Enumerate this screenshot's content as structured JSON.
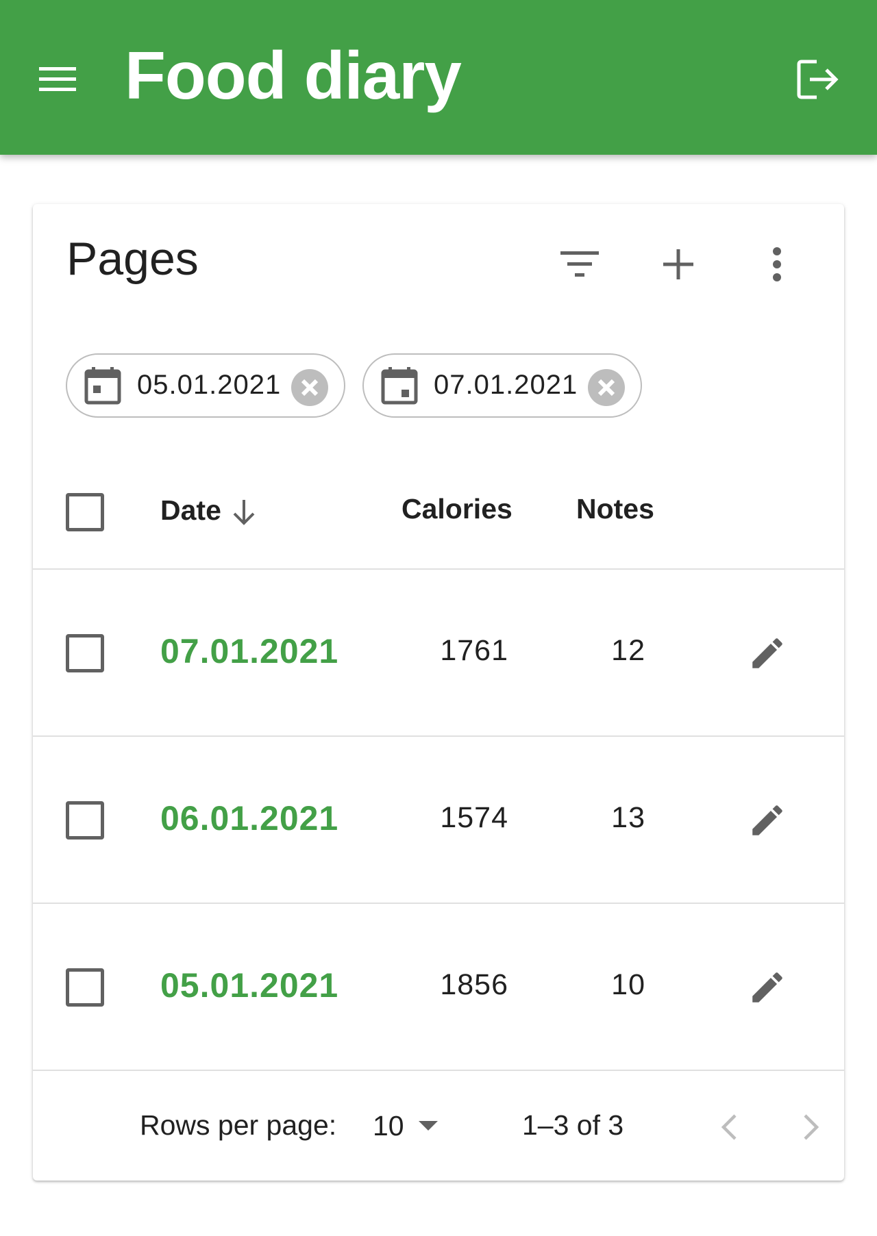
{
  "app": {
    "title": "Food diary",
    "color": "#43a047",
    "menu_icon": "menu-icon",
    "logout_icon": "logout-icon"
  },
  "card": {
    "title": "Pages",
    "tools": [
      "filter-icon",
      "add-icon",
      "more-vert-icon"
    ]
  },
  "filters": [
    {
      "icon": "calendar-icon",
      "value": "05.01.2021"
    },
    {
      "icon": "calendar-icon",
      "value": "07.01.2021"
    }
  ],
  "table": {
    "columns": {
      "date": "Date",
      "calories": "Calories",
      "notes": "Notes"
    },
    "sort": {
      "column": "Date",
      "direction": "descending"
    },
    "rows": [
      {
        "date": "07.01.2021",
        "calories": "1761",
        "notes": "12",
        "checked": false
      },
      {
        "date": "06.01.2021",
        "calories": "1574",
        "notes": "13",
        "checked": false
      },
      {
        "date": "05.01.2021",
        "calories": "1856",
        "notes": "10",
        "checked": false
      }
    ]
  },
  "pagination": {
    "rows_per_page_label": "Rows per page:",
    "rows_per_page": "10",
    "range": "1–3 of 3"
  }
}
